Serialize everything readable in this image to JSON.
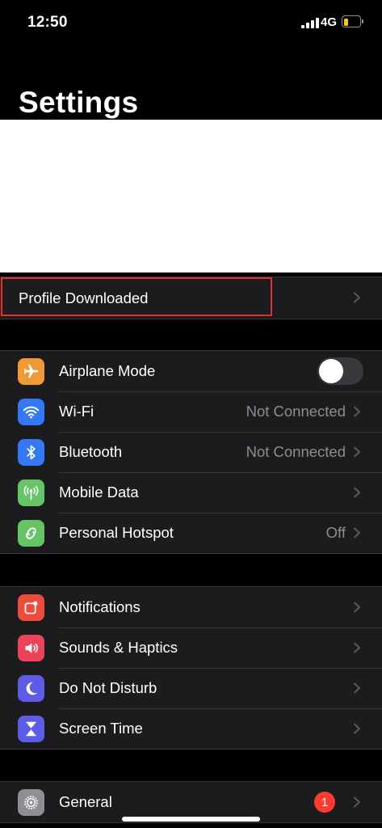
{
  "status_bar": {
    "time": "12:50",
    "network": "4G"
  },
  "page_title": "Settings",
  "profile": {
    "label": "Profile Downloaded"
  },
  "connectivity": [
    {
      "id": "airplane",
      "label": "Airplane Mode",
      "value": "",
      "color": "#f09a37",
      "icon": "airplane-icon",
      "toggle": false
    },
    {
      "id": "wifi",
      "label": "Wi-Fi",
      "value": "Not Connected",
      "color": "#3478f6",
      "icon": "wifi-icon"
    },
    {
      "id": "bluetooth",
      "label": "Bluetooth",
      "value": "Not Connected",
      "color": "#3478f6",
      "icon": "bluetooth-icon"
    },
    {
      "id": "mobile-data",
      "label": "Mobile Data",
      "value": "",
      "color": "#65c466",
      "icon": "antenna-icon"
    },
    {
      "id": "hotspot",
      "label": "Personal Hotspot",
      "value": "Off",
      "color": "#65c466",
      "icon": "hotspot-icon"
    }
  ],
  "notifications_group": [
    {
      "id": "notifications",
      "label": "Notifications",
      "color": "#eb4d3d",
      "icon": "notifications-icon"
    },
    {
      "id": "sounds",
      "label": "Sounds & Haptics",
      "color": "#eb445a",
      "icon": "speaker-icon"
    },
    {
      "id": "dnd",
      "label": "Do Not Disturb",
      "color": "#5e5ce6",
      "icon": "moon-icon"
    },
    {
      "id": "screen-time",
      "label": "Screen Time",
      "color": "#5e5ce6",
      "icon": "hourglass-icon"
    }
  ],
  "general": {
    "label": "General",
    "badge": "1",
    "color": "#8e8e93",
    "icon": "gear-icon"
  }
}
